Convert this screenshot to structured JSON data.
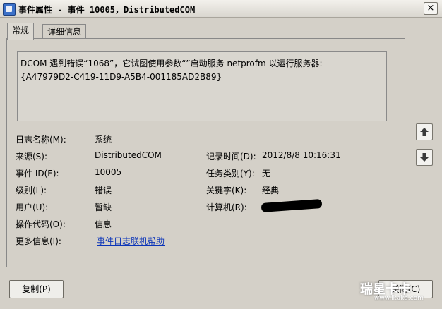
{
  "window": {
    "title": "事件属性 - 事件 10005，DistributedCOM",
    "close_glyph": "×"
  },
  "tabs": [
    {
      "label": "常规"
    },
    {
      "label": "详细信息"
    }
  ],
  "description": {
    "line1": "DCOM 遇到错误“1068”，它试图使用参数“”启动服务 netprofm 以运行服务器:",
    "line2": "{A47979D2-C419-11D9-A5B4-001185AD2B89}"
  },
  "fields": {
    "log_name": {
      "label": "日志名称(M):",
      "value": "系统"
    },
    "source": {
      "label": "来源(S):",
      "value": "DistributedCOM"
    },
    "logged": {
      "label": "记录时间(D):",
      "value": "2012/8/8 10:16:31"
    },
    "event_id": {
      "label": "事件 ID(E):",
      "value": "10005"
    },
    "task_category": {
      "label": "任务类别(Y):",
      "value": "无"
    },
    "level": {
      "label": "级别(L):",
      "value": "错误"
    },
    "keywords": {
      "label": "关键字(K):",
      "value": "经典"
    },
    "user": {
      "label": "用户(U):",
      "value": "暂缺"
    },
    "computer": {
      "label": "计算机(R):",
      "value": ""
    },
    "opcode": {
      "label": "操作代码(O):",
      "value": "信息"
    },
    "more_info": {
      "label": "更多信息(I):",
      "link": "事件日志联机帮助"
    }
  },
  "nav": {
    "up_icon": "arrow-up-icon",
    "down_icon": "arrow-down-icon"
  },
  "buttons": {
    "copy": "复制(P)",
    "close": "关闭(C)"
  },
  "watermark": {
    "text": "瑞星卡卡",
    "sub": "www.ikaka.com"
  }
}
